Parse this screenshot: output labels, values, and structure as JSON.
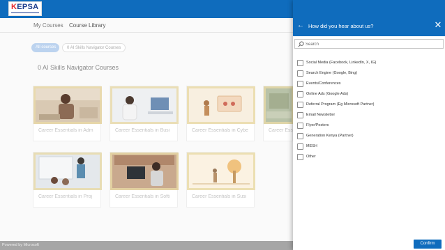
{
  "header": {
    "logo_text_k": "K",
    "logo_text_rest": "EPSA",
    "brand_color": "#0f6cbd"
  },
  "nav": {
    "tabs": [
      {
        "label": "My Courses",
        "active": false
      },
      {
        "label": "Course Library",
        "active": true
      }
    ]
  },
  "filters": {
    "chips": [
      {
        "label": "All courses",
        "active": true
      },
      {
        "label": "0 AI Skills Navigator Courses",
        "active": false
      }
    ]
  },
  "library": {
    "section_title": "0 AI Skills Navigator Courses",
    "courses": [
      {
        "title": "Career Essentials in Adm"
      },
      {
        "title": "Career Essentials in Busi"
      },
      {
        "title": "Career Essentials in Cybe"
      },
      {
        "title": "Career Essentials in"
      },
      {
        "title": "Career Essentials in Proj"
      },
      {
        "title": "Career Essentials in Softi"
      },
      {
        "title": "Career Essentials in Susi"
      }
    ]
  },
  "footer": {
    "text": "Powered by Microsoft"
  },
  "panel": {
    "title": "How did you hear about us?",
    "search_placeholder": "Search",
    "options": [
      {
        "label": "Social Media (Facebook, LinkedIn, X, IG)",
        "checked": false
      },
      {
        "label": "Search Engine (Google, Bing)",
        "checked": false
      },
      {
        "label": "Events/Conferences",
        "checked": false
      },
      {
        "label": "Online Ads (Google Ads)",
        "checked": false
      },
      {
        "label": "Referral Program (Eg Microsoft Partner)",
        "checked": false
      },
      {
        "label": "Email Newsletter",
        "checked": false
      },
      {
        "label": "Flyer/Posters",
        "checked": false
      },
      {
        "label": "Generation Kenya (Partner)",
        "checked": false
      },
      {
        "label": "MESH",
        "checked": false
      },
      {
        "label": "Other",
        "checked": false
      }
    ],
    "confirm_label": "Confirm"
  }
}
